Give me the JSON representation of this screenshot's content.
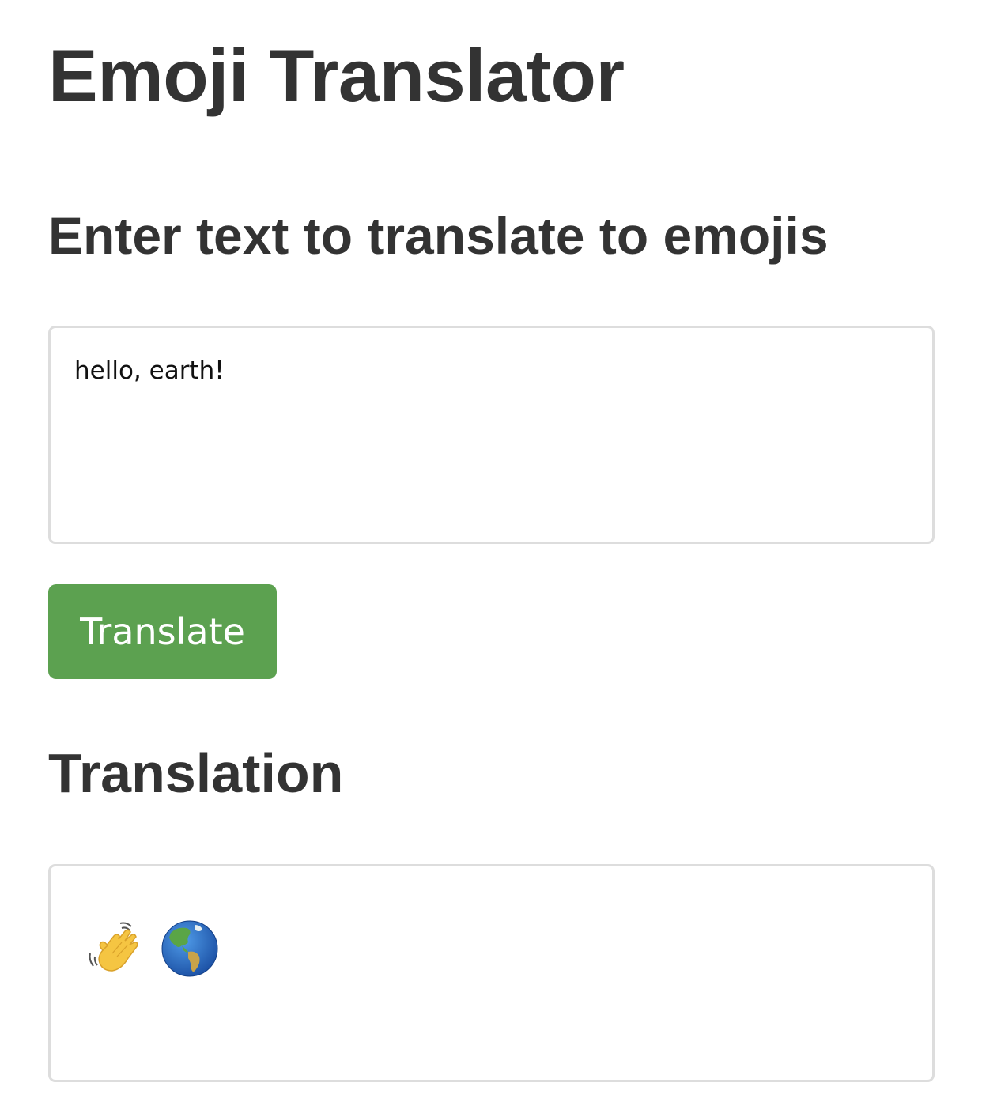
{
  "header": {
    "title": "Emoji Translator"
  },
  "input_section": {
    "heading": "Enter text to translate to emojis",
    "text_value": "hello, earth!"
  },
  "actions": {
    "translate_label": "Translate"
  },
  "output_section": {
    "heading": "Translation",
    "emojis": [
      {
        "icon": "waving-hand-icon",
        "glyph": "👋"
      },
      {
        "icon": "globe-americas-icon",
        "glyph": "🌎"
      }
    ]
  },
  "colors": {
    "button_background": "#5ca150",
    "button_text": "#ffffff",
    "heading_text": "#333333",
    "box_border": "#dddddd"
  }
}
